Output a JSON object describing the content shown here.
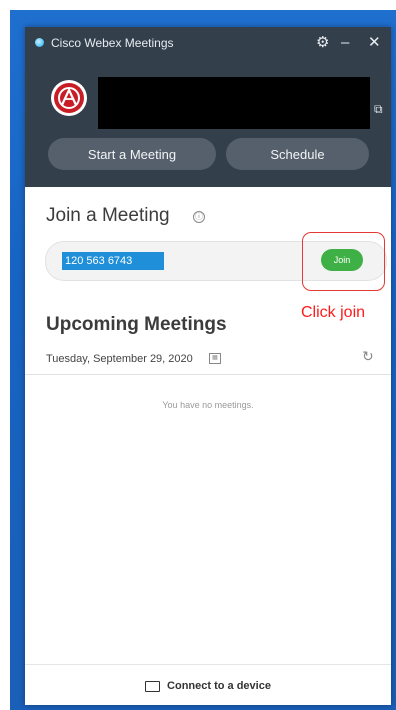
{
  "window": {
    "title": "Cisco Webex Meetings",
    "icons": {
      "settings": "gear-icon",
      "minimize": "minimize-icon",
      "close": "close-icon"
    }
  },
  "header": {
    "copy_icon": "copy-icon",
    "buttons": {
      "start": "Start a Meeting",
      "schedule": "Schedule"
    }
  },
  "join": {
    "title": "Join a Meeting",
    "info_icon": "ⓘ",
    "meeting_number": "120 563 6743",
    "join_label": "Join"
  },
  "annotation": {
    "text": "Click join",
    "color": "#ff1a1a"
  },
  "upcoming": {
    "title": "Upcoming Meetings",
    "date": "Tuesday, September 29, 2020",
    "empty_text": "You have no meetings."
  },
  "footer": {
    "connect_label": "Connect to a device"
  },
  "colors": {
    "header_bg": "#333f4b",
    "join_green": "#3fb045",
    "selection_blue": "#1e8fd8",
    "desktop_blue": "#1a66c8"
  }
}
